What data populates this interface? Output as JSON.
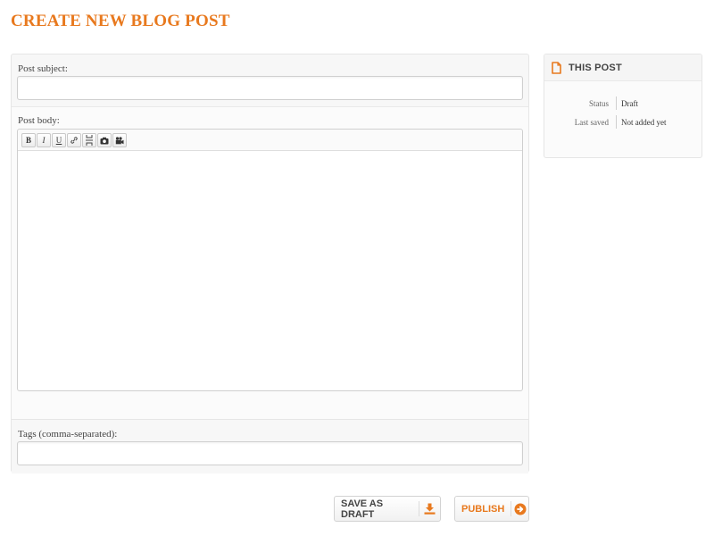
{
  "page": {
    "title": "CREATE NEW BLOG POST"
  },
  "form": {
    "subject_label": "Post subject:",
    "subject_value": "",
    "body_label": "Post body:",
    "body_value": "",
    "tags_label": "Tags (comma-separated):",
    "tags_value": ""
  },
  "editor_toolbar": {
    "buttons": [
      {
        "name": "bold",
        "glyph": "B"
      },
      {
        "name": "italic",
        "glyph": "I"
      },
      {
        "name": "underline",
        "glyph": "U"
      },
      {
        "name": "link",
        "icon": "link-icon"
      },
      {
        "name": "page-break",
        "icon": "page-break-icon"
      },
      {
        "name": "insert-image",
        "icon": "camera-icon"
      },
      {
        "name": "insert-video",
        "icon": "video-camera-icon"
      }
    ]
  },
  "sidebar": {
    "title": "THIS POST",
    "icon": "document-icon",
    "rows": [
      {
        "key": "Status",
        "value": "Draft"
      },
      {
        "key": "Last saved",
        "value": "Not added yet"
      }
    ]
  },
  "actions": {
    "save_draft_label": "SAVE AS DRAFT",
    "save_draft_icon": "download-icon",
    "publish_label": "PUBLISH",
    "publish_icon": "arrow-right-circle-icon"
  },
  "colors": {
    "accent": "#e8791e",
    "panel_bg": "#f7f7f7",
    "border": "#e6e6e6"
  }
}
